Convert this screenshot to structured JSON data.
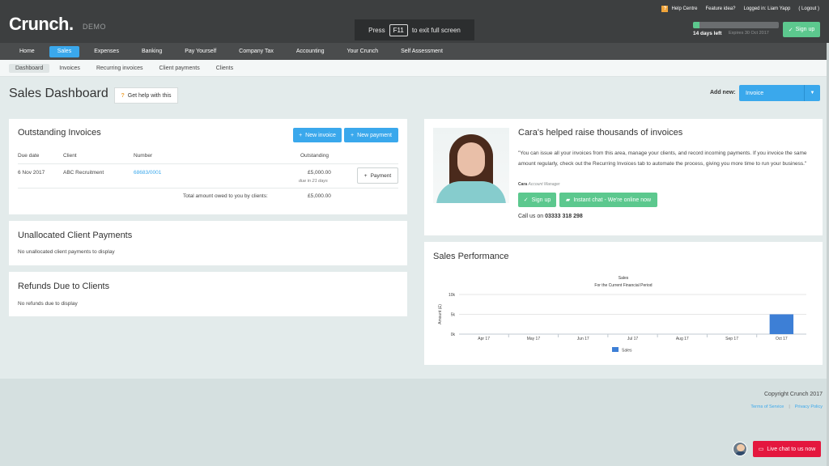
{
  "header": {
    "logo": "Crunch.",
    "logo_suffix": "DEMO",
    "f11_pre": "Press",
    "f11_key": "F11",
    "f11_post": "to exit full screen",
    "help_centre": "Help Centre",
    "feature_idea": "Feature idea?",
    "logged_in": "Logged in: Liam Yapp",
    "logout": "( Logout )",
    "trial_progress": 0.08,
    "trial_days": "14 days left",
    "trial_expires": "Expires 30 Oct 2017",
    "signup": "Sign up"
  },
  "nav": {
    "items": [
      {
        "label": "Home",
        "active": false
      },
      {
        "label": "Sales",
        "active": true
      },
      {
        "label": "Expenses",
        "active": false
      },
      {
        "label": "Banking",
        "active": false
      },
      {
        "label": "Pay Yourself",
        "active": false
      },
      {
        "label": "Company Tax",
        "active": false
      },
      {
        "label": "Accounting",
        "active": false
      },
      {
        "label": "Your Crunch",
        "active": false
      },
      {
        "label": "Self Assessment",
        "active": false
      }
    ]
  },
  "subnav": {
    "items": [
      {
        "label": "Dashboard",
        "active": true
      },
      {
        "label": "Invoices",
        "active": false
      },
      {
        "label": "Recurring invoices",
        "active": false
      },
      {
        "label": "Client payments",
        "active": false
      },
      {
        "label": "Clients",
        "active": false
      }
    ]
  },
  "page": {
    "title": "Sales Dashboard",
    "help_button": "Get help with this",
    "add_new_label": "Add new:",
    "add_new_value": "Invoice"
  },
  "outstanding": {
    "title": "Outstanding Invoices",
    "new_invoice": "New invoice",
    "new_payment": "New payment",
    "columns": [
      "Due date",
      "Client",
      "Number",
      "Outstanding"
    ],
    "rows": [
      {
        "due_date": "6 Nov 2017",
        "client": "ABC Recruitment",
        "number": "68683/0001",
        "amount": "£5,000.00",
        "due_note": "due in 21 days",
        "action": "Payment"
      }
    ],
    "total_label": "Total amount owed to you by clients:",
    "total_value": "£5,000.00"
  },
  "unallocated": {
    "title": "Unallocated Client Payments",
    "empty": "No unallocated client payments to display"
  },
  "refunds": {
    "title": "Refunds Due to Clients",
    "empty": "No refunds due to display"
  },
  "cara": {
    "title": "Cara's helped raise thousands of invoices",
    "quote": "\"You can issue all your invoices from this area, manage your clients, and record incoming payments. If you invoice the same amount regularly, check out the Recurring Invoices tab to automate the process, giving you more time to run your business.\"",
    "name": "Cara",
    "role": "Account Manager",
    "signup": "Sign up",
    "chat": "Instant chat - We're online now",
    "call_prefix": "Call us on",
    "phone": "03333 318 298"
  },
  "performance": {
    "title": "Sales Performance"
  },
  "chart_data": {
    "type": "bar",
    "title": "Sales",
    "subtitle": "For the Current Financial Period",
    "ylabel": "Amount (£)",
    "xlabel": "",
    "categories": [
      "Apr 17",
      "May 17",
      "Jun 17",
      "Jul 17",
      "Aug 17",
      "Sep 17",
      "Oct 17"
    ],
    "series": [
      {
        "name": "Sales",
        "values": [
          0,
          0,
          0,
          0,
          0,
          0,
          5000
        ]
      }
    ],
    "yticks": [
      "0k",
      "5k",
      "10k"
    ],
    "ylim": [
      0,
      10000
    ],
    "grid": true,
    "legend": "bottom",
    "colors": {
      "bar": "#3d7fd6"
    }
  },
  "footer": {
    "copyright": "Copyright Crunch 2017",
    "terms": "Terms of Service",
    "sep": "|",
    "privacy": "Privacy Policy",
    "live_chat": "Live chat to us now"
  },
  "colors": {
    "accent": "#3aa8ec",
    "green": "#5cc88e",
    "red": "#e4173e",
    "header": "#3d3f40"
  }
}
